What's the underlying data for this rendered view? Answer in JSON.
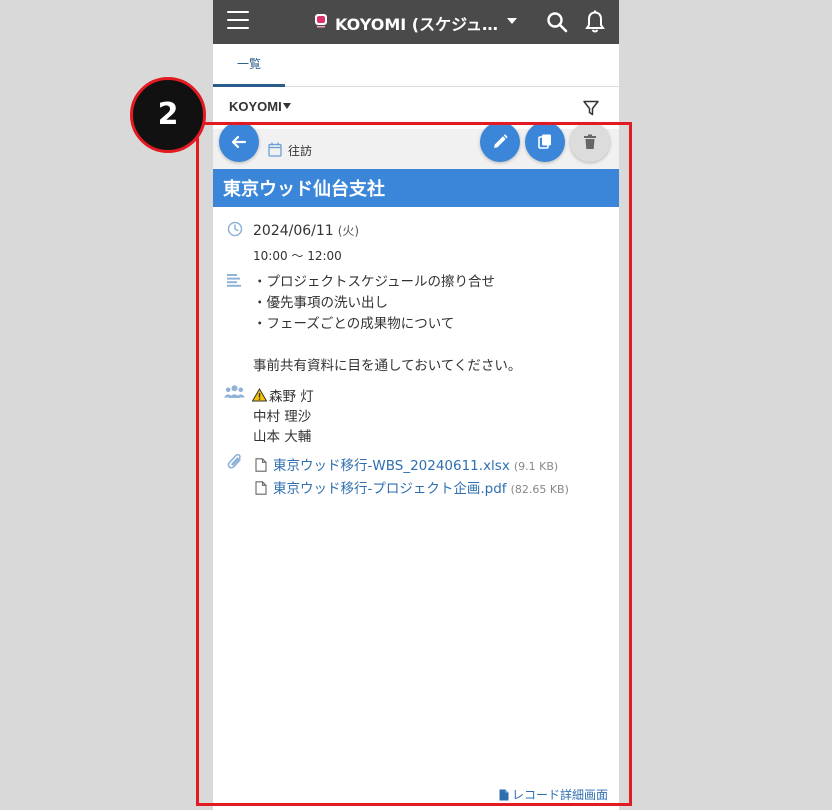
{
  "header": {
    "app_title": "KOYOMI (スケジュ…",
    "icons": [
      "menu-icon",
      "app-icon",
      "chevron-down-icon",
      "search-icon",
      "bell-icon"
    ]
  },
  "tabs": [
    {
      "label": "一覧",
      "active": true
    }
  ],
  "view_selector": {
    "label": "KOYOMI"
  },
  "record": {
    "category": "往訪",
    "title": "東京ウッド仙台支社",
    "date": "2024/06/11",
    "day_of_week": "(火)",
    "time": "10:00 ～ 12:00",
    "memo": [
      "・プロジェクトスケジュールの擦り合せ",
      "・優先事項の洗い出し",
      "・フェーズごとの成果物について",
      "",
      "事前共有資料に目を通しておいてください。"
    ],
    "attendees": [
      {
        "name": "森野 灯",
        "warning": true
      },
      {
        "name": "中村 理沙",
        "warning": false
      },
      {
        "name": "山本 大輔",
        "warning": false
      }
    ],
    "attachments": [
      {
        "name": "東京ウッド移行-WBS_20240611.xlsx",
        "size": "(9.1 KB)"
      },
      {
        "name": "東京ウッド移行-プロジェクト企画.pdf",
        "size": "(82.65 KB)"
      }
    ],
    "detail_link": "レコード詳細画面"
  },
  "annotation": {
    "step_number": "2"
  },
  "colors": {
    "header_bg": "#4a4a4a",
    "accent_blue": "#3b86d8",
    "link_blue": "#2f6fb0",
    "highlight_red": "#e21a22",
    "field_icon": "#8fb2d9"
  }
}
